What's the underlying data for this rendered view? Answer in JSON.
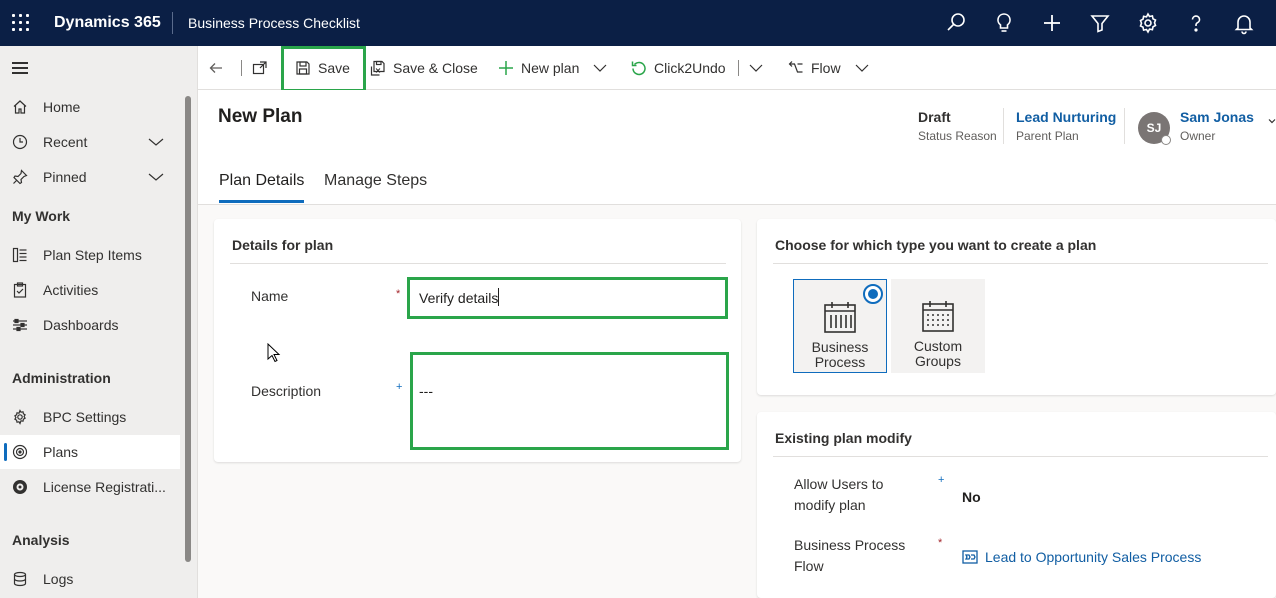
{
  "topbar": {
    "brand": "Dynamics 365",
    "app_title": "Business Process Checklist",
    "icons": [
      "search-icon",
      "lightbulb-icon",
      "plus-icon",
      "filter-icon",
      "gear-icon",
      "help-icon",
      "bell-icon"
    ]
  },
  "sidebar": {
    "items": [
      {
        "label": "Home",
        "icon": "home-icon"
      },
      {
        "label": "Recent",
        "icon": "clock-icon"
      },
      {
        "label": "Pinned",
        "icon": "pin-icon"
      }
    ],
    "groups": [
      {
        "title": "My Work",
        "items": [
          {
            "label": "Plan Step Items",
            "icon": "list-icon"
          },
          {
            "label": "Activities",
            "icon": "clipboard-icon"
          },
          {
            "label": "Dashboards",
            "icon": "dashboard-icon"
          }
        ]
      },
      {
        "title": "Administration",
        "items": [
          {
            "label": "BPC Settings",
            "icon": "gear-icon"
          },
          {
            "label": "Plans",
            "icon": "target-icon"
          },
          {
            "label": "License Registrati...",
            "icon": "license-icon"
          }
        ]
      },
      {
        "title": "Analysis",
        "items": [
          {
            "label": "Logs",
            "icon": "database-icon"
          }
        ]
      }
    ]
  },
  "commandbar": {
    "save": "Save",
    "save_close": "Save & Close",
    "new_plan": "New plan",
    "click2undo": "Click2Undo",
    "flow": "Flow"
  },
  "header": {
    "title": "New Plan",
    "status_value": "Draft",
    "status_label": "Status Reason",
    "parent_value": "Lead Nurturing",
    "parent_label": "Parent Plan",
    "owner_initials": "SJ",
    "owner_value": "Sam Jonas",
    "owner_label": "Owner",
    "colors": {
      "topbar": "#0b1f45",
      "accent": "#0f6cbd",
      "highlight": "#2aa54a"
    }
  },
  "tabs": [
    {
      "label": "Plan Details",
      "active": true
    },
    {
      "label": "Manage Steps",
      "active": false
    }
  ],
  "details": {
    "title": "Details for plan",
    "name_label": "Name",
    "name_required": "*",
    "name_value": "Verify details",
    "description_label": "Description",
    "description_recommended": "+",
    "description_value": "---"
  },
  "plan_type": {
    "title": "Choose for which type you want to create a plan",
    "options": [
      {
        "label": "Business Process",
        "selected": true
      },
      {
        "label": "Custom Groups",
        "selected": false
      }
    ]
  },
  "existing": {
    "title": "Existing plan modify",
    "allow_label": "Allow Users to modify plan",
    "allow_recommended": "+",
    "allow_value": "No",
    "bpf_label": "Business Process Flow",
    "bpf_required": "*",
    "bpf_value": "Lead to Opportunity Sales Process"
  }
}
